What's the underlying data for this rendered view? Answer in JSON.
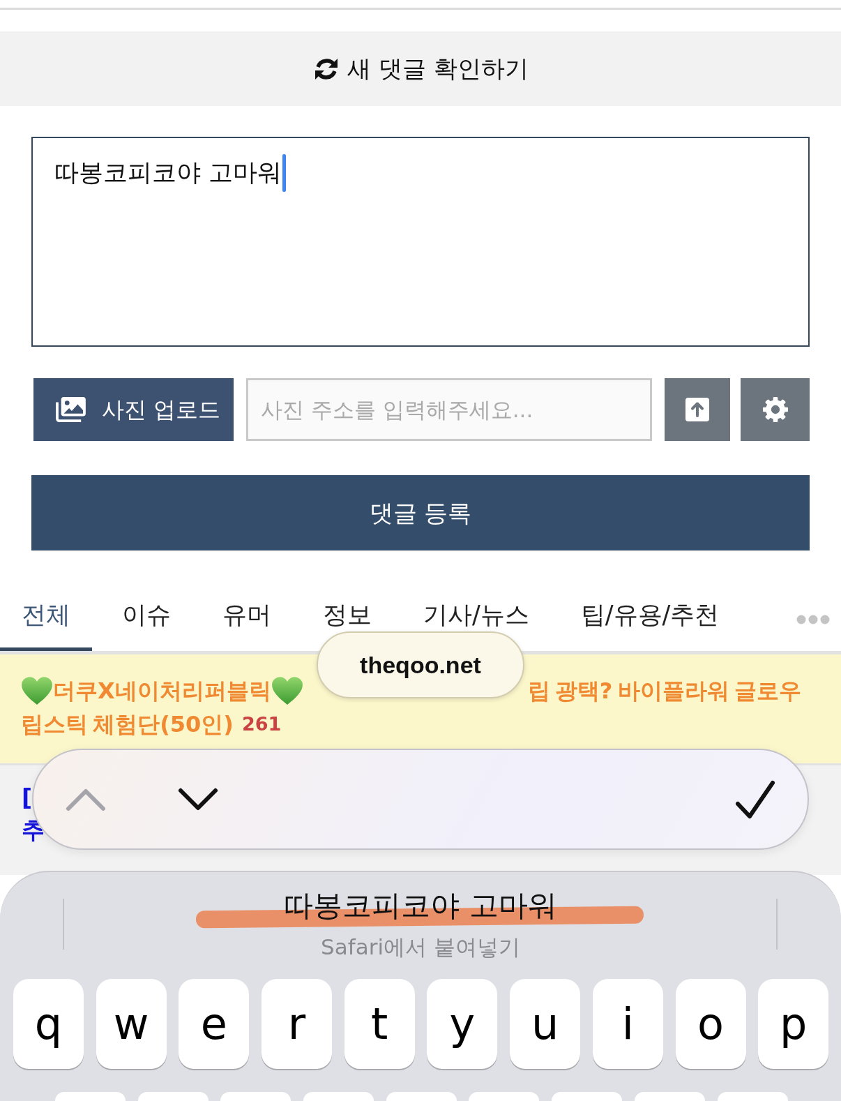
{
  "refresh_button": {
    "label": "새 댓글 확인하기"
  },
  "comment_box": {
    "value": "따봉코피코야 고마워",
    "focused": true
  },
  "photo_upload": {
    "button_label": "사진 업로드",
    "url_field": {
      "placeholder": "사진 주소를 입력해주세요..."
    },
    "tool_buttons": [
      {
        "kind": "upload"
      },
      {
        "kind": "settings"
      }
    ]
  },
  "submit_button": {
    "label": "댓글 등록"
  },
  "tabs": [
    {
      "label": "전체",
      "selected": true
    },
    {
      "label": "이슈",
      "selected": false
    },
    {
      "label": "유머",
      "selected": false
    },
    {
      "label": "정보",
      "selected": false
    },
    {
      "label": "기사/뉴스",
      "selected": false
    },
    {
      "label": "팁/유용/추천",
      "selected": false
    }
  ],
  "url_pill": {
    "text": "theqoo.net"
  },
  "notice_banner": {
    "lines": [
      [
        {
          "kind": "heart"
        },
        {
          "kind": "text",
          "text": "더쿠X네이처리퍼블릭"
        },
        {
          "kind": "heart"
        },
        {
          "kind": "covered"
        },
        {
          "kind": "text",
          "text": "립 광택? 바이플라워 글로우"
        }
      ],
      [
        {
          "kind": "text",
          "text": "립스틱 체험단(50인)"
        },
        {
          "kind": "count",
          "text": "261"
        }
      ]
    ]
  },
  "post_row": {
    "lines": [
      "[",
      "추"
    ]
  },
  "find_toolbar": {
    "buttons": [
      {
        "kind": "previous",
        "disabled": true
      },
      {
        "kind": "next",
        "disabled": false
      },
      {
        "kind": "done",
        "disabled": false
      }
    ]
  },
  "keyboard": {
    "suggestion": {
      "text": "따봉코피코야 고마워",
      "source": "Safari에서 붙여넣기",
      "marked": true
    },
    "rows": [
      {
        "keys": [
          {
            "kind": "letter",
            "label": "q"
          },
          {
            "kind": "letter",
            "label": "w"
          },
          {
            "kind": "letter",
            "label": "e"
          },
          {
            "kind": "letter",
            "label": "r"
          },
          {
            "kind": "letter",
            "label": "t"
          },
          {
            "kind": "letter",
            "label": "y"
          },
          {
            "kind": "letter",
            "label": "u"
          },
          {
            "kind": "letter",
            "label": "i"
          },
          {
            "kind": "letter",
            "label": "o"
          },
          {
            "kind": "letter",
            "label": "p"
          }
        ]
      },
      {
        "keys": [
          {
            "kind": "cut_off"
          },
          {
            "kind": "cut_off"
          },
          {
            "kind": "cut_off"
          },
          {
            "kind": "cut_off"
          },
          {
            "kind": "cut_off"
          },
          {
            "kind": "cut_off"
          },
          {
            "kind": "cut_off"
          },
          {
            "kind": "cut_off"
          },
          {
            "kind": "cut_off"
          }
        ]
      }
    ]
  }
}
